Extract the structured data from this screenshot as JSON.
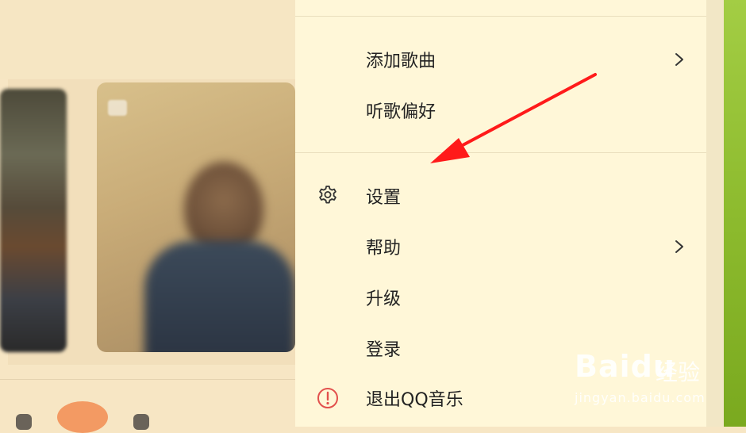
{
  "menu": {
    "items": [
      {
        "label": "添加歌曲",
        "has_submenu": true,
        "icon": null
      },
      {
        "label": "听歌偏好",
        "has_submenu": false,
        "icon": null
      },
      {
        "label": "设置",
        "has_submenu": false,
        "icon": "gear-icon"
      },
      {
        "label": "帮助",
        "has_submenu": true,
        "icon": null
      },
      {
        "label": "升级",
        "has_submenu": false,
        "icon": null
      },
      {
        "label": "登录",
        "has_submenu": false,
        "icon": null
      },
      {
        "label": "退出QQ音乐",
        "has_submenu": false,
        "icon": "exit-icon"
      }
    ]
  },
  "colors": {
    "menu_bg": "#fff7d8",
    "page_bg": "#f7e6c4",
    "arrow": "#ff1a1a",
    "exit_icon": "#e2504d",
    "accent_green": "#a3cd44"
  },
  "annotation": {
    "type": "red-arrow",
    "points_to": "设置"
  },
  "watermark": {
    "brand": "Baidu",
    "brand_cn": "经验",
    "url": "jingyan.baidu.com"
  }
}
